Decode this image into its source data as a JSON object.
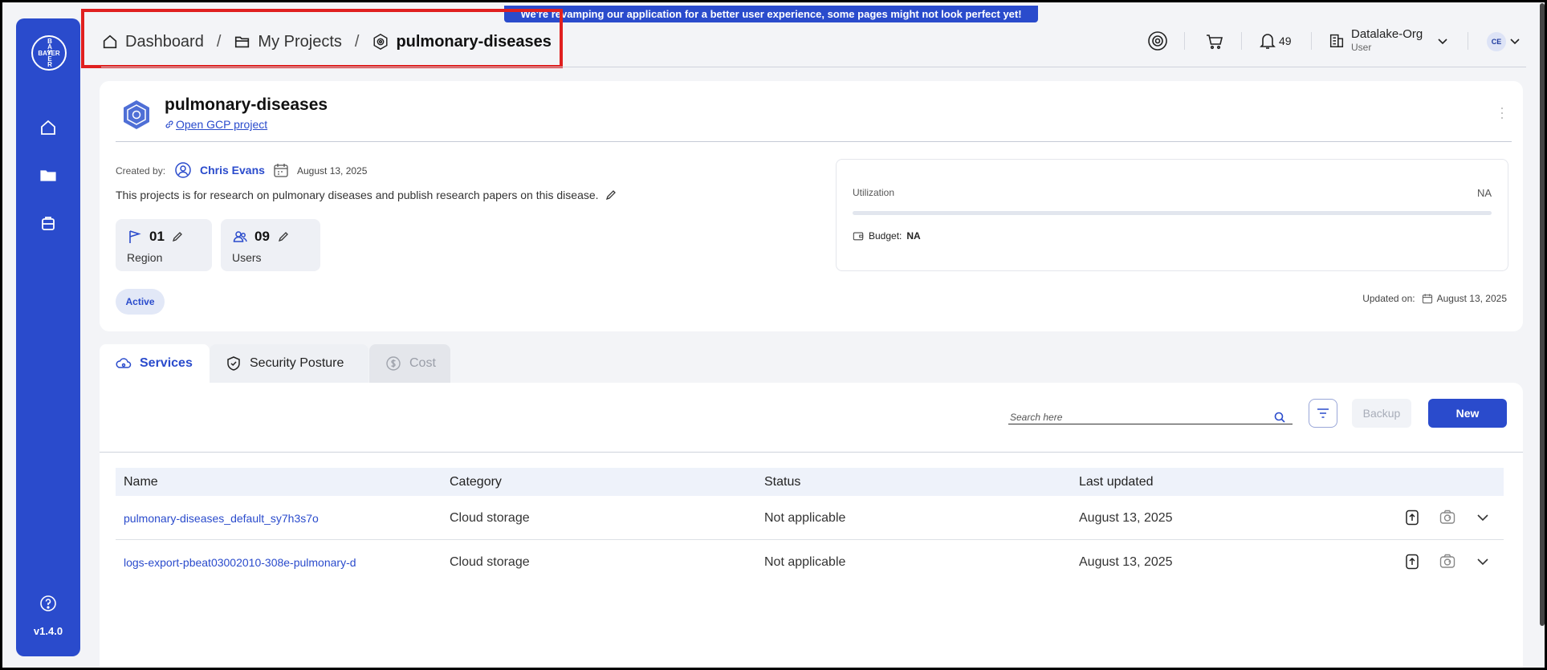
{
  "banner": {
    "text": "We're revamping our application for a better user experience, some pages might not look perfect yet!"
  },
  "sidebar": {
    "logo_vertical": "B A Y E R",
    "logo_horizontal": "BAYER",
    "version": "v1.4.0"
  },
  "breadcrumb": {
    "items": [
      {
        "label": "Dashboard",
        "icon": "home-icon"
      },
      {
        "label": "My Projects",
        "icon": "folder-icon"
      },
      {
        "label": "pulmonary-diseases",
        "icon": "project-gear-icon"
      }
    ],
    "separator": "/"
  },
  "header": {
    "notifications_count": "49",
    "org_name": "Datalake-Org",
    "org_role": "User",
    "avatar_initials": "CE"
  },
  "project": {
    "title": "pulmonary-diseases",
    "gcp_link": "Open GCP project",
    "created_by_label": "Created by:",
    "created_by": "Chris Evans",
    "created_date": "August 13, 2025",
    "description": "This projects is for research on pulmonary diseases and publish research papers on this disease.",
    "region_count": "01",
    "region_label": "Region",
    "users_count": "09",
    "users_label": "Users",
    "status": "Active",
    "utilization_label": "Utilization",
    "utilization_value": "NA",
    "utilization_fraction": 0,
    "budget_label": "Budget:",
    "budget_value": "NA",
    "updated_label": "Updated on:",
    "updated_date": "August 13, 2025"
  },
  "tabs": [
    {
      "label": "Services",
      "active": true
    },
    {
      "label": "Security Posture",
      "active": false
    },
    {
      "label": "Cost",
      "active": false,
      "disabled": true
    }
  ],
  "services": {
    "search_placeholder": "Search here",
    "backup_label": "Backup",
    "new_label": "New",
    "columns": [
      "Name",
      "Category",
      "Status",
      "Last updated"
    ],
    "rows": [
      {
        "name": "pulmonary-diseases_default_sy7h3s7o",
        "category": "Cloud storage",
        "status": "Not applicable",
        "updated": "August 13, 2025"
      },
      {
        "name": "logs-export-pbeat03002010-308e-pulmonary-d",
        "category": "Cloud storage",
        "status": "Not applicable",
        "updated": "August 13, 2025"
      }
    ]
  },
  "colors": {
    "accent": "#2a4bcc",
    "highlight": "#e02020"
  }
}
